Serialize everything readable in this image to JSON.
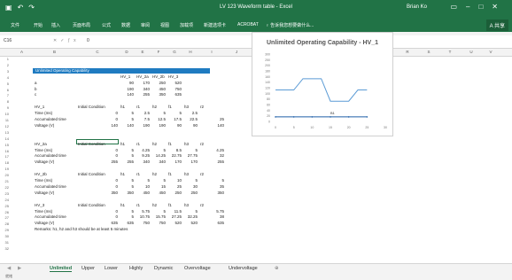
{
  "window": {
    "title": "LV 123 Waveform table - Excel",
    "user": "Brian Ko",
    "qat_icons": [
      "save-icon",
      "undo-icon",
      "redo-icon"
    ]
  },
  "ribbon": {
    "tabs": [
      "文件",
      "开始",
      "插入",
      "页面布局",
      "公式",
      "数据",
      "审阅",
      "视图",
      "加载项",
      "新建选项卡",
      "ACROBAT",
      "♀ 告诉我您想要做什么..."
    ],
    "share": "A 共享"
  },
  "formula_bar": {
    "name_box": "C16",
    "formula": "0"
  },
  "columns": [
    "A",
    "B",
    "C",
    "D",
    "E",
    "F",
    "G",
    "H",
    "I",
    "J",
    "K",
    "L",
    "M",
    "N",
    "O",
    "P",
    "Q",
    "R",
    "S",
    "T",
    "U",
    "V"
  ],
  "rows": [
    "1",
    "2",
    "3",
    "4",
    "5",
    "6",
    "7",
    "8",
    "9",
    "10",
    "11",
    "12",
    "13",
    "14",
    "15",
    "16",
    "17",
    "18",
    "19",
    "20",
    "21",
    "22",
    "23",
    "24",
    "25",
    "26",
    "27",
    "28",
    "29",
    "30",
    "31",
    "32"
  ],
  "sheet": {
    "section_title": "Unlimited Operating Capability",
    "table1": {
      "headers": [
        "HV_1",
        "HV_2a",
        "HV_2b",
        "HV_3"
      ],
      "rows": [
        [
          "a",
          "90",
          "170",
          "250",
          "520"
        ],
        [
          "b",
          "190",
          "340",
          "450",
          "750"
        ],
        [
          "c",
          "140",
          "255",
          "350",
          "635"
        ]
      ]
    },
    "blocks": [
      {
        "name": "HV_1",
        "headers": [
          "Initial Condition",
          "h1",
          "r1",
          "h2",
          "f1",
          "h3",
          "r2"
        ],
        "rows": [
          [
            "Time (ms)",
            "0",
            "5",
            "2.5",
            "5",
            "5",
            "2.5"
          ],
          [
            "Accumulated time",
            "0",
            "5",
            "7.5",
            "12.5",
            "17.5",
            "22.5",
            "25"
          ],
          [
            "Voltage (V)",
            "140",
            "140",
            "190",
            "190",
            "90",
            "90",
            "140"
          ]
        ]
      },
      {
        "name": "HV_2a",
        "headers": [
          "Initial Condition",
          "h1",
          "r1",
          "h2",
          "f1",
          "h3",
          "r2"
        ],
        "rows": [
          [
            "Time (ms)",
            "0",
            "5",
            "4.25",
            "5",
            "8.5",
            "5",
            "4.25"
          ],
          [
            "Accumulated time",
            "0",
            "5",
            "9.25",
            "14.25",
            "22.75",
            "27.75",
            "32"
          ],
          [
            "Voltage (V)",
            "255",
            "255",
            "340",
            "340",
            "170",
            "170",
            "255"
          ]
        ]
      },
      {
        "name": "HV_2b",
        "headers": [
          "Initial Condition",
          "h1",
          "r1",
          "h2",
          "f1",
          "h3",
          "r2"
        ],
        "rows": [
          [
            "Time (ms)",
            "0",
            "5",
            "5",
            "5",
            "10",
            "5",
            "5"
          ],
          [
            "Accumulated time",
            "0",
            "5",
            "10",
            "15",
            "25",
            "30",
            "35"
          ],
          [
            "Voltage (V)",
            "350",
            "350",
            "450",
            "450",
            "250",
            "250",
            "350"
          ]
        ]
      },
      {
        "name": "HV_3",
        "headers": [
          "Initial Condition",
          "h1",
          "r1",
          "h2",
          "f1",
          "h3",
          "r2"
        ],
        "rows": [
          [
            "Time (ms)",
            "0",
            "5",
            "5.75",
            "5",
            "11.5",
            "5",
            "5.75"
          ],
          [
            "Accumulated time",
            "0",
            "5",
            "10.75",
            "15.75",
            "27.25",
            "32.25",
            "38"
          ],
          [
            "Voltage (V)",
            "635",
            "635",
            "750",
            "750",
            "520",
            "520",
            "635"
          ]
        ]
      }
    ],
    "remark": "Remarks: h1, h2 and h3 should be at least 5 minutes"
  },
  "chart_data": {
    "type": "line",
    "title": "Unlimited Operating Capability - HV_1",
    "ylim": [
      0,
      300
    ],
    "xlim": [
      0,
      30
    ],
    "yticks": [
      "300",
      "250",
      "200",
      "180",
      "160",
      "140",
      "120",
      "100",
      "80",
      "60",
      "40",
      "20",
      "0"
    ],
    "xticks": [
      "0",
      "5",
      "10",
      "15",
      "20",
      "25",
      "30"
    ],
    "series": [
      {
        "name": "",
        "color": "#5b9bd5",
        "x": [
          0,
          5,
          7.5,
          12.5,
          15,
          20,
          22.5,
          25
        ],
        "y": [
          140,
          140,
          190,
          190,
          90,
          90,
          140,
          140
        ]
      },
      {
        "name": "",
        "color": "#1f5fa8",
        "label": "B1",
        "x": [
          0,
          5,
          10,
          15,
          20,
          25
        ],
        "y": [
          20,
          20,
          20,
          20,
          20,
          20
        ]
      }
    ]
  },
  "sheet_tabs": [
    "Unlimited",
    "Upper",
    "Lower",
    "Highly",
    "Dynamic",
    "Overvoltage",
    "Undervoltage"
  ],
  "status_bar": "就绪"
}
